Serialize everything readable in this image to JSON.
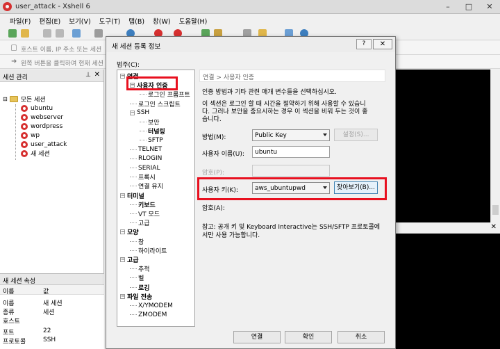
{
  "app": {
    "title": "user_attack - Xshell 6",
    "menu": [
      "파일(F)",
      "편집(E)",
      "보기(V)",
      "도구(T)",
      "탭(B)",
      "창(W)",
      "도움말(H)"
    ],
    "address_placeholder": "호스트 이름, IP 주소 또는 세션",
    "hint_text": "왼쪽 버튼을 클릭하여 현재 세션",
    "accent_color": "#d63030"
  },
  "session_manager": {
    "title": "세션 관리",
    "root": "모든 세션",
    "sessions": [
      "ubuntu",
      "webserver",
      "wordpress",
      "wp",
      "user_attack",
      "새 세션"
    ]
  },
  "session_properties": {
    "title": "새 세션 속성",
    "col_name": "이름",
    "col_value": "값",
    "rows": [
      {
        "k": "이름",
        "v": "새 세션"
      },
      {
        "k": "종류",
        "v": "세션"
      },
      {
        "k": "호스트",
        "v": ""
      },
      {
        "k": "포트",
        "v": "22"
      },
      {
        "k": "프로토콜",
        "v": "SSH"
      }
    ]
  },
  "dialog": {
    "title": "새 세션 등록 정보",
    "category_label": "범주(C):",
    "categories": [
      {
        "label": "연결",
        "level": 0,
        "bold": true,
        "exp": "−"
      },
      {
        "label": "사용자 인증",
        "level": 1,
        "bold": true,
        "exp": "−",
        "selected": true
      },
      {
        "label": "로그인 프롬프트",
        "level": 2
      },
      {
        "label": "로그인 스크립트",
        "level": 1
      },
      {
        "label": "SSH",
        "level": 1,
        "exp": "−"
      },
      {
        "label": "보안",
        "level": 2
      },
      {
        "label": "터널링",
        "level": 2,
        "bold": true
      },
      {
        "label": "SFTP",
        "level": 2
      },
      {
        "label": "TELNET",
        "level": 1
      },
      {
        "label": "RLOGIN",
        "level": 1
      },
      {
        "label": "SERIAL",
        "level": 1
      },
      {
        "label": "프록시",
        "level": 1
      },
      {
        "label": "연결 유지",
        "level": 1
      },
      {
        "label": "터미널",
        "level": 0,
        "bold": true,
        "exp": "−"
      },
      {
        "label": "키보드",
        "level": 1,
        "bold": true
      },
      {
        "label": "VT 모드",
        "level": 1
      },
      {
        "label": "고급",
        "level": 1
      },
      {
        "label": "모양",
        "level": 0,
        "bold": true,
        "exp": "−"
      },
      {
        "label": "창",
        "level": 1
      },
      {
        "label": "하이라이트",
        "level": 1
      },
      {
        "label": "고급",
        "level": 0,
        "bold": true,
        "exp": "−"
      },
      {
        "label": "추적",
        "level": 1
      },
      {
        "label": "벨",
        "level": 1
      },
      {
        "label": "로깅",
        "level": 1,
        "bold": true
      },
      {
        "label": "파일 전송",
        "level": 0,
        "bold": true,
        "exp": "−"
      },
      {
        "label": "X/YMODEM",
        "level": 1
      },
      {
        "label": "ZMODEM",
        "level": 1
      }
    ],
    "breadcrumb": "연결 > 사용자 인증",
    "description": "인증 방법과 기타 관련 매개 변수들을 선택하십시오.",
    "note_line1": "이 섹션은 로그인 할 때 시간을 절약하기 위해 사용할 수 있습니",
    "note_line2": "다. 그러나 보안을 중요시하는 경우 이 섹션을 비워 두는 것이 좋",
    "note_line3": "습니다.",
    "method_label": "방법(M):",
    "method_value": "Public Key",
    "settings_button": "설정(S)...",
    "username_label": "사용자 이름(U):",
    "username_value": "ubuntu",
    "password_label": "암호(P):",
    "userkey_label": "사용자 키(K):",
    "userkey_value": "aws_ubuntupwd",
    "browse_button": "찾아보기(B)...",
    "passphrase_label": "암호(A):",
    "footnote_line1": "참고: 공개 키 및 Keyboard Interactive는 SSH/SFTP 프로토콜에",
    "footnote_line2": "서만 사용 가능합니다.",
    "connect_button": "연결",
    "ok_button": "확인",
    "cancel_button": "취소",
    "highlight_color": "#e8101f"
  }
}
